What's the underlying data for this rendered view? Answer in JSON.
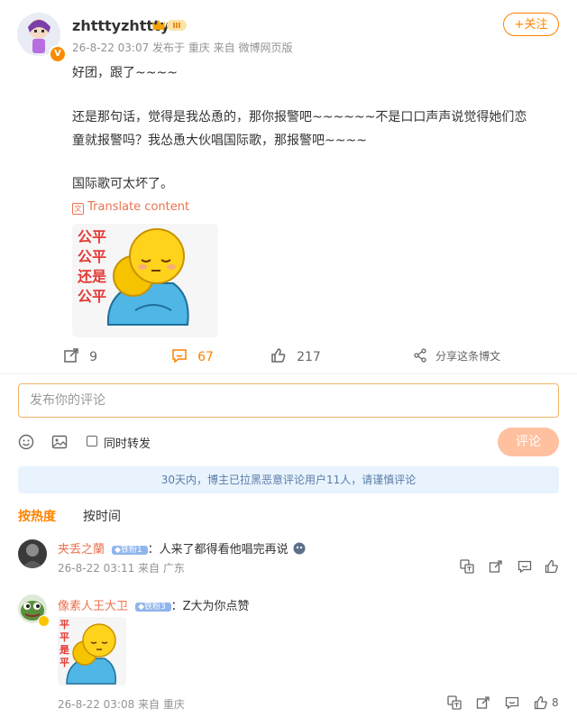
{
  "post": {
    "username": "zhtttyzhttty",
    "level_badge": "III",
    "verified_badge": "V",
    "meta": "26-8-22 03:07  发布于 重庆  来自 微博网页版",
    "follow_label": "+关注",
    "lines": [
      "好团，跟了~~~~",
      "还是那句话，觉得是我怂恿的，那你报警吧~~~~~~不是口口声声说觉得她们恋",
      "童就报警吗？我怂恿大伙唱国际歌，那报警吧~~~~",
      "国际歌可太坏了。"
    ],
    "translate_label": "Translate content",
    "image_text": [
      "公平",
      "公平",
      "还是",
      "公平"
    ],
    "repost_count": "9",
    "comment_count": "67",
    "like_count": "217",
    "share_label": "分享这条博文"
  },
  "composer": {
    "placeholder": "发布你的评论",
    "repost_label": "同时转发",
    "submit_label": "评论"
  },
  "notice": "30天内，博主已拉黑恶意评论用户11人，请谨慎评论",
  "sort": {
    "hot": "按热度",
    "time": "按时间"
  },
  "comments": [
    {
      "name": "夹丢之蘭",
      "fan_badge": "铁粉1",
      "text": "：人来了都得看他唱完再说",
      "meta": "26-8-22 03:11  来自 广东",
      "likes": ""
    },
    {
      "name": "像素人王大卫",
      "fan_badge": "铁粉3",
      "text": "：Z大为你点赞",
      "meta": "26-8-22 03:08  来自 重庆",
      "image_text": [
        "平",
        "平",
        "是",
        "平"
      ],
      "likes": "8"
    }
  ],
  "colors": {
    "accent": "#ff8200",
    "link": "#eb7350",
    "notice_bg": "#e8f3fd"
  }
}
